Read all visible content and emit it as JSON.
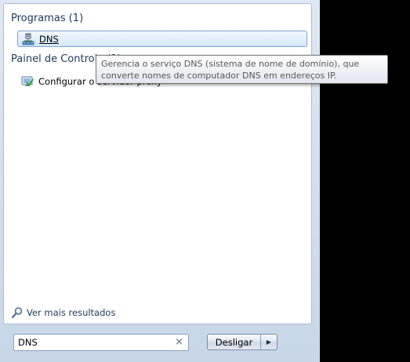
{
  "programs": {
    "title": "Programas (1)",
    "items": [
      {
        "label": "DNS",
        "icon": "dns-server-icon"
      }
    ]
  },
  "control_panel": {
    "title": "Painel de Controle (1)",
    "items": [
      {
        "label": "Configurar o servidor proxy",
        "icon": "control-panel-icon"
      }
    ]
  },
  "see_more": {
    "label": "Ver mais resultados",
    "icon": "search-icon"
  },
  "search": {
    "value": "DNS",
    "clear_symbol": "×"
  },
  "shutdown": {
    "label": "Desligar",
    "arrow": "▶"
  },
  "tooltip": {
    "text": "Gerencia o serviço DNS (sistema de nome de domínio), que converte nomes de computador DNS em endereços IP."
  },
  "colors": {
    "accent": "#1e395b",
    "selection_border": "#7da2ce",
    "background": "#000000"
  }
}
